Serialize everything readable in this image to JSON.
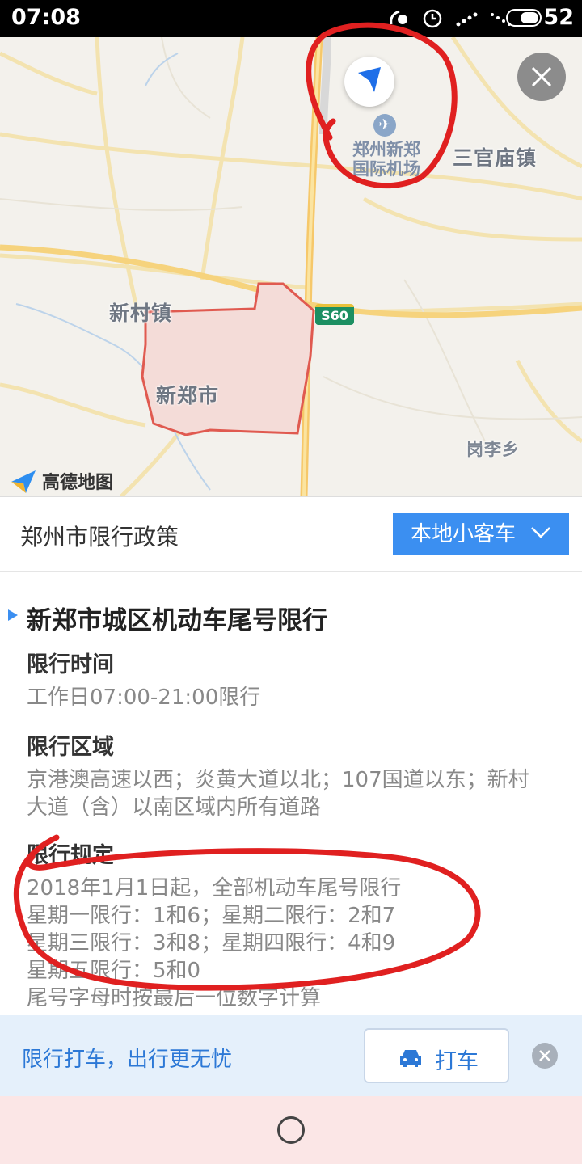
{
  "status_bar": {
    "time": "07:08",
    "battery_level": "52",
    "icons": [
      "nfc-icon",
      "alarm-icon",
      "signal-4g-icon",
      "signal-icon",
      "battery-icon"
    ]
  },
  "map": {
    "labels": {
      "xincun": "新村镇",
      "xinzheng": "新郑市",
      "sanguanmiao": "三官庙镇",
      "ganglixiang": "岗李乡",
      "airport_line1": "郑州新郑",
      "airport_line2": "国际机场"
    },
    "road_shield": "S60",
    "logo_text": "高德地图",
    "highlight_color": "#e05a50",
    "region_fill": "#f4dcd8"
  },
  "panel": {
    "title": "郑州市限行政策",
    "vehicle_select": "本地小客车"
  },
  "policy": {
    "title": "新郑市城区机动车尾号限行",
    "sections": [
      {
        "heading": "限行时间",
        "lines": [
          "工作日07:00-21:00限行"
        ]
      },
      {
        "heading": "限行区域",
        "lines": [
          "京港澳高速以西；炎黄大道以北；107国道以东；新村",
          "大道（含）以南区域内所有道路"
        ]
      },
      {
        "heading": "限行规定",
        "lines": [
          "2018年1月1日起，全部机动车尾号限行",
          "星期一限行：1和6；星期二限行：2和7",
          "星期三限行：3和8；星期四限行：4和9",
          "星期五限行：5和0",
          "尾号字母时按最后一位数字计算"
        ]
      }
    ]
  },
  "promo": {
    "text": "限行打车，出行更无忧",
    "taxi_button": "打车"
  },
  "colors": {
    "accent": "#3b8ff1",
    "promo_text": "#2c78d6",
    "annotation_red": "#e02020"
  }
}
